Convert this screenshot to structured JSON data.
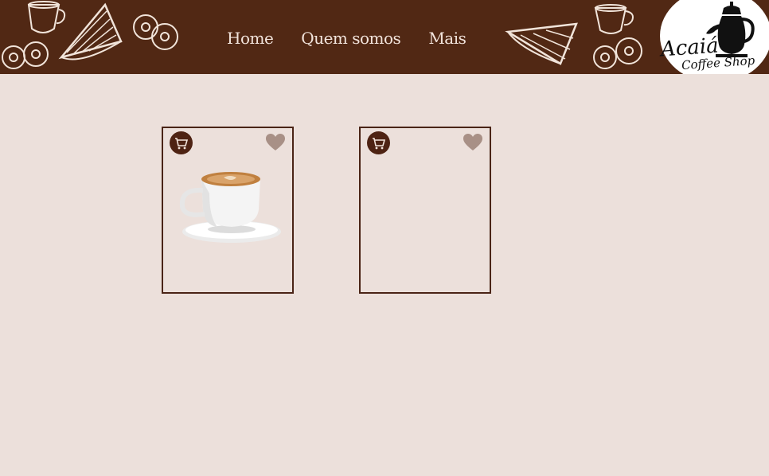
{
  "nav": {
    "items": [
      {
        "label": "Home"
      },
      {
        "label": "Quem somos"
      },
      {
        "label": "Mais"
      }
    ]
  },
  "logo": {
    "title": "Acaiá",
    "subtitle": "Coffee Shop"
  },
  "colors": {
    "header_bg": "#512814",
    "page_bg": "#ece0db",
    "card_border": "#4a2416",
    "cart_button": "#4e2313",
    "heart": "#a89086"
  },
  "products": [
    {
      "image": "coffee-cup",
      "cart_icon": "cart-icon",
      "fav_icon": "heart-icon"
    },
    {
      "image": "",
      "cart_icon": "cart-icon",
      "fav_icon": "heart-icon"
    }
  ]
}
